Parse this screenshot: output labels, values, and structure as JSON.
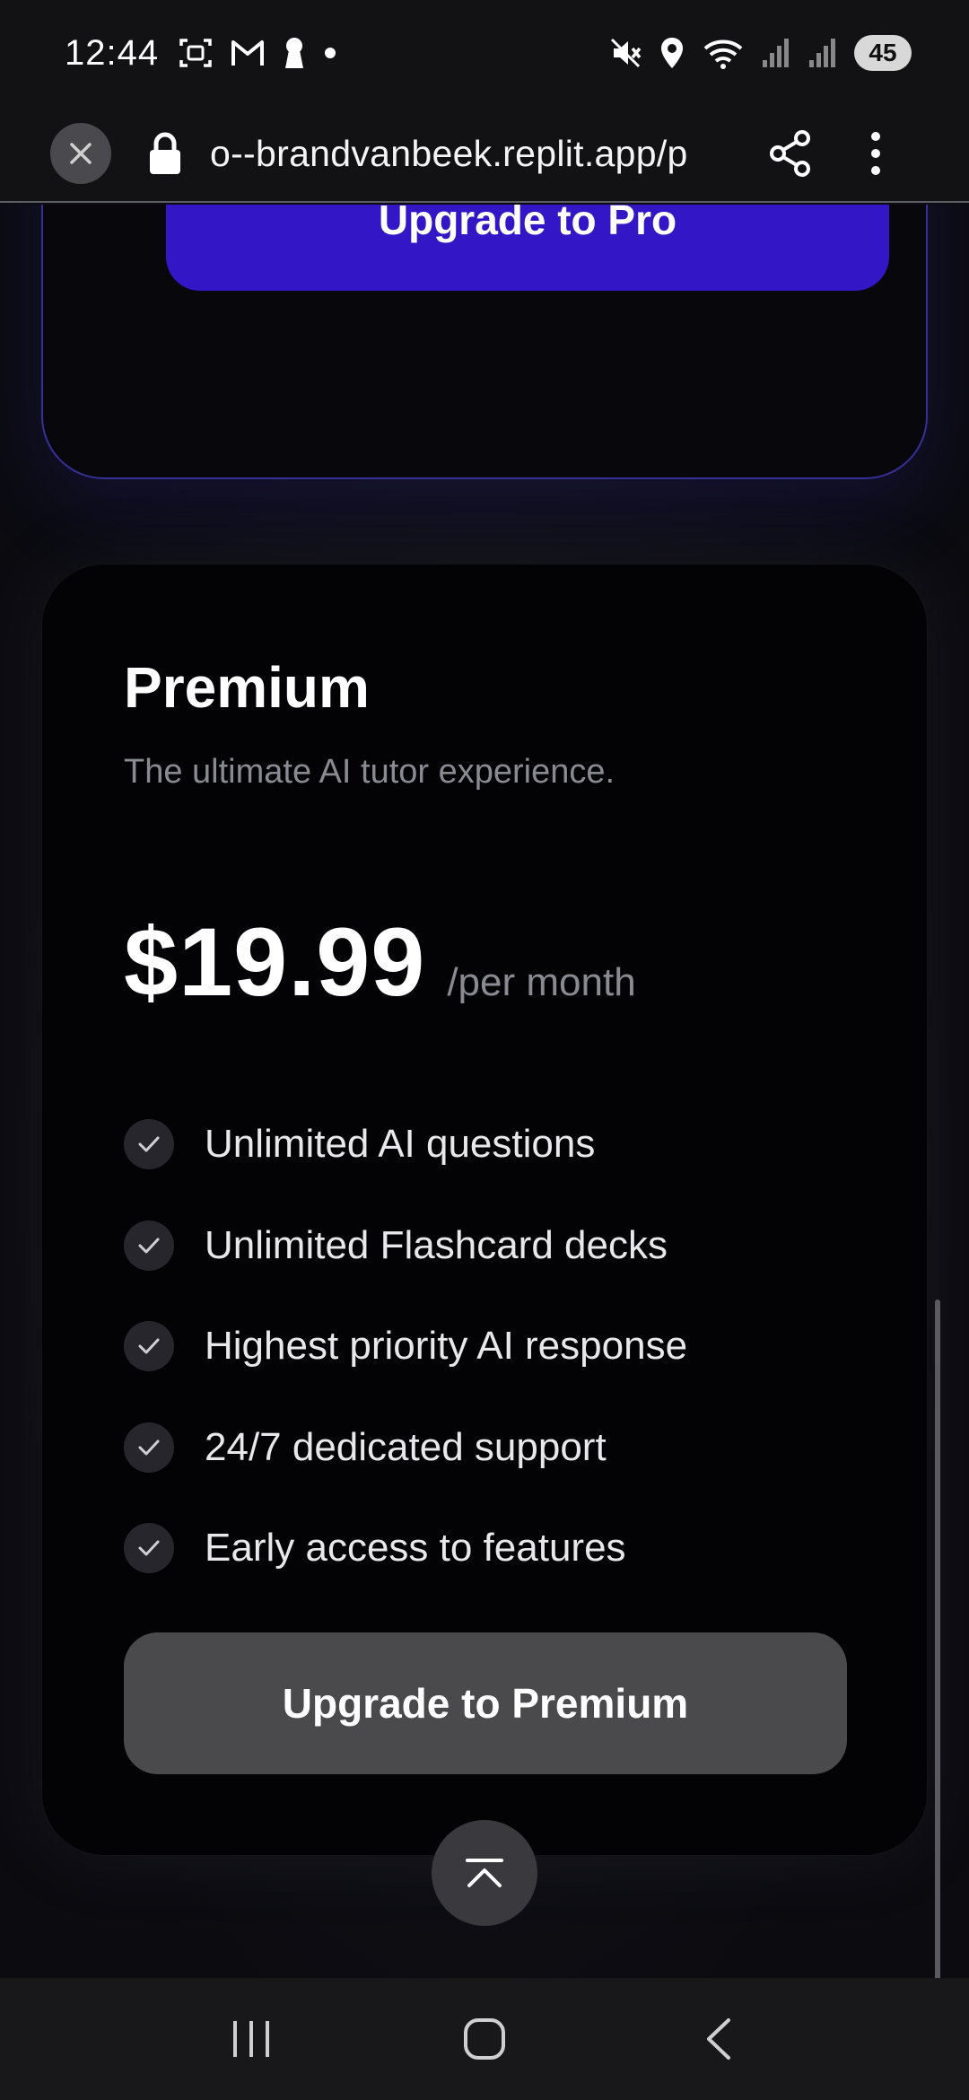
{
  "status_bar": {
    "time": "12:44",
    "battery": "45"
  },
  "browser": {
    "url": "o--brandvanbeek.replit.app/p"
  },
  "pro_plan": {
    "cta": "Upgrade to Pro"
  },
  "premium_plan": {
    "name": "Premium",
    "description": "The ultimate AI tutor experience.",
    "price": "$19.99",
    "period": "/per month",
    "features": [
      "Unlimited AI questions",
      "Unlimited Flashcard decks",
      "Highest priority AI response",
      "24/7 dedicated support",
      "Early access to features"
    ],
    "cta": "Upgrade to Premium"
  },
  "colors": {
    "pro_button": "#3317c7",
    "premium_button": "#4a4a4c",
    "background": "#0c0c12"
  }
}
